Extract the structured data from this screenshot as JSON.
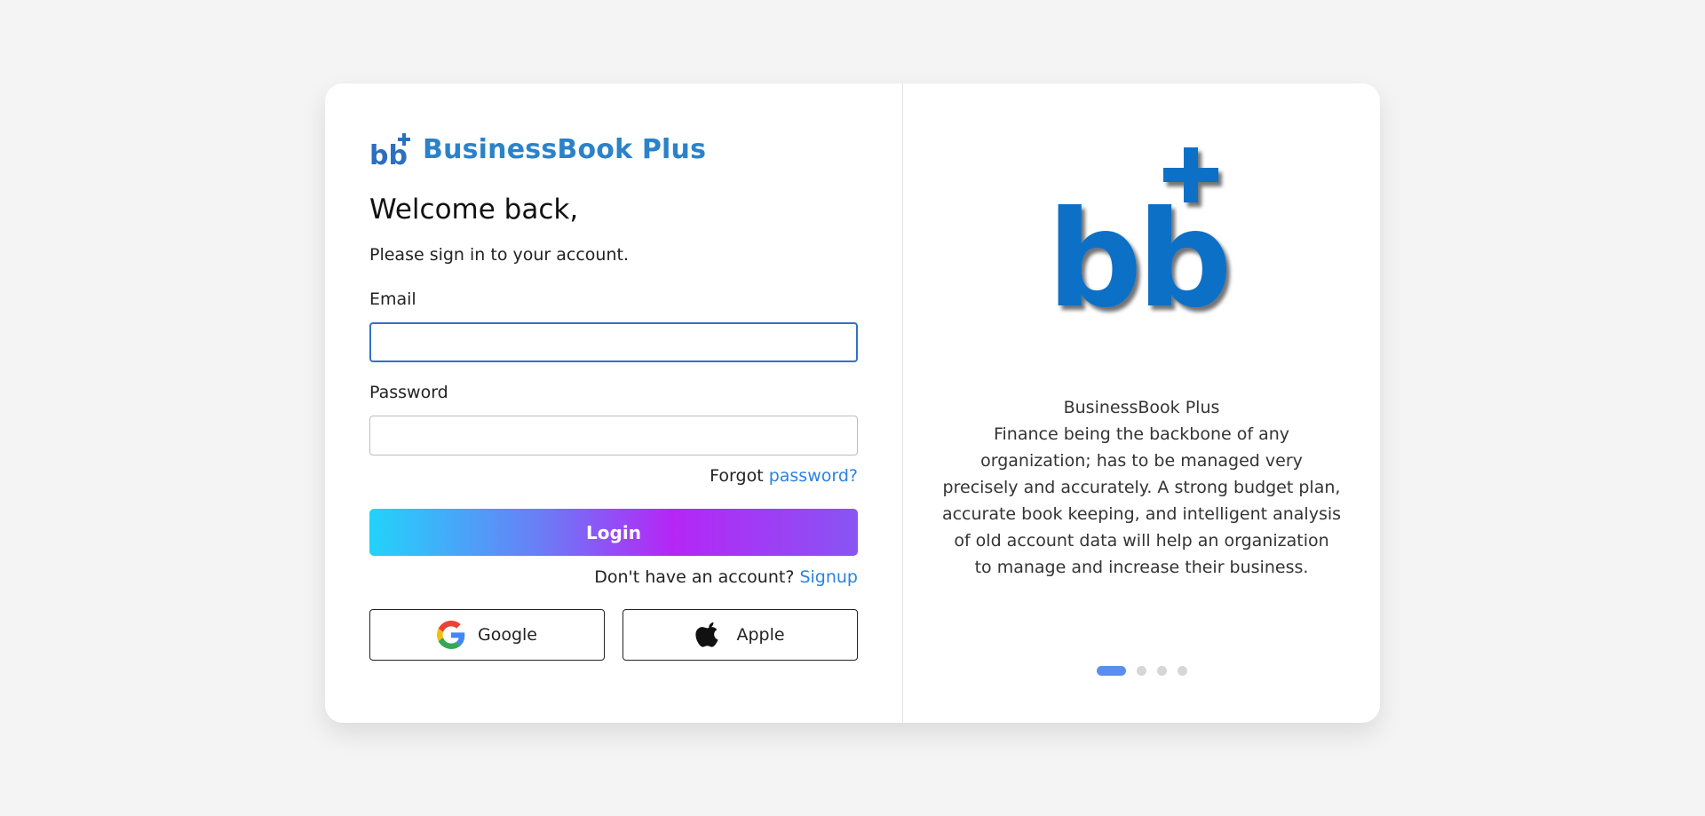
{
  "brand": {
    "name": "BusinessBook Plus",
    "color": "#2b82c9"
  },
  "login": {
    "welcome": "Welcome back,",
    "subtitle": "Please sign in to your account.",
    "email_label": "Email",
    "email_value": "",
    "password_label": "Password",
    "password_value": "",
    "forgot_prefix": "Forgot",
    "forgot_link": "password?",
    "login_button": "Login",
    "signup_prefix": "Don't have an account?",
    "signup_link": "Signup",
    "google_button": "Google",
    "apple_button": "Apple"
  },
  "carousel": {
    "title": "BusinessBook Plus",
    "lines": [
      "Finance being the backbone of any",
      "organization; has to be managed very",
      "precisely and accurately. A strong budget plan,",
      "accurate book keeping, and intelligent analysis",
      "of old account data will help an organization",
      "to manage and increase their business."
    ],
    "slide_count": 4,
    "active_slide": 1
  },
  "colors": {
    "accent": "#2b82e0",
    "logo_blue": "#0a6fc7",
    "gradient_start": "#22d3fb",
    "gradient_mid": "#b526f6",
    "gradient_end": "#8855f3",
    "active_dot": "#5b8def"
  },
  "icons": {
    "brand": "bb-plus-logo",
    "google": "google-icon",
    "apple": "apple-icon"
  }
}
